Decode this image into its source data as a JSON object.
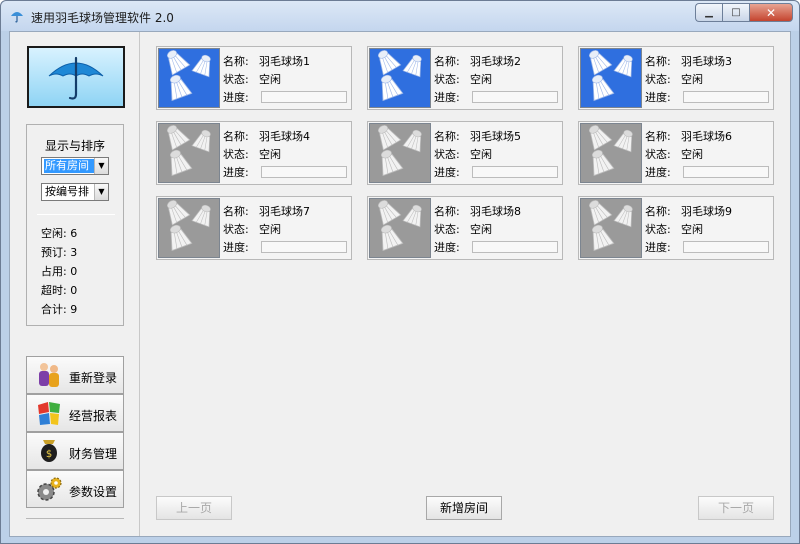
{
  "window": {
    "title": "速用羽毛球场管理软件 2.0"
  },
  "sidebar": {
    "group_title": "显示与排序",
    "filter": {
      "value": "所有房间"
    },
    "sort": {
      "value": "按编号排"
    },
    "stats": [
      {
        "label": "空闲:",
        "value": "6"
      },
      {
        "label": "预订:",
        "value": "3"
      },
      {
        "label": "占用:",
        "value": "0"
      },
      {
        "label": "超时:",
        "value": "0"
      },
      {
        "label": "合计:",
        "value": "9"
      }
    ],
    "buttons": [
      {
        "label": "重新登录",
        "icon": "users-icon"
      },
      {
        "label": "经营报表",
        "icon": "report-icon"
      },
      {
        "label": "财务管理",
        "icon": "finance-icon"
      },
      {
        "label": "参数设置",
        "icon": "gear-icon"
      }
    ]
  },
  "labels": {
    "name": "名称:",
    "status": "状态:",
    "progress": "进度:"
  },
  "courts": [
    {
      "name": "羽毛球场1",
      "status": "空闲",
      "image": "active",
      "progress": 0
    },
    {
      "name": "羽毛球场2",
      "status": "空闲",
      "image": "active",
      "progress": 0
    },
    {
      "name": "羽毛球场3",
      "status": "空闲",
      "image": "active",
      "progress": 0
    },
    {
      "name": "羽毛球场4",
      "status": "空闲",
      "image": "idle",
      "progress": 0
    },
    {
      "name": "羽毛球场5",
      "status": "空闲",
      "image": "idle",
      "progress": 0
    },
    {
      "name": "羽毛球场6",
      "status": "空闲",
      "image": "idle",
      "progress": 0
    },
    {
      "name": "羽毛球场7",
      "status": "空闲",
      "image": "idle",
      "progress": 0
    },
    {
      "name": "羽毛球场8",
      "status": "空闲",
      "image": "idle",
      "progress": 0
    },
    {
      "name": "羽毛球场9",
      "status": "空闲",
      "image": "idle",
      "progress": 0
    }
  ],
  "footer": {
    "prev": "上一页",
    "add": "新增房间",
    "next": "下一页"
  },
  "colors": {
    "active_tile": "#2f6fdf",
    "idle_tile": "#9a9a9a",
    "selection": "#3399ff"
  }
}
